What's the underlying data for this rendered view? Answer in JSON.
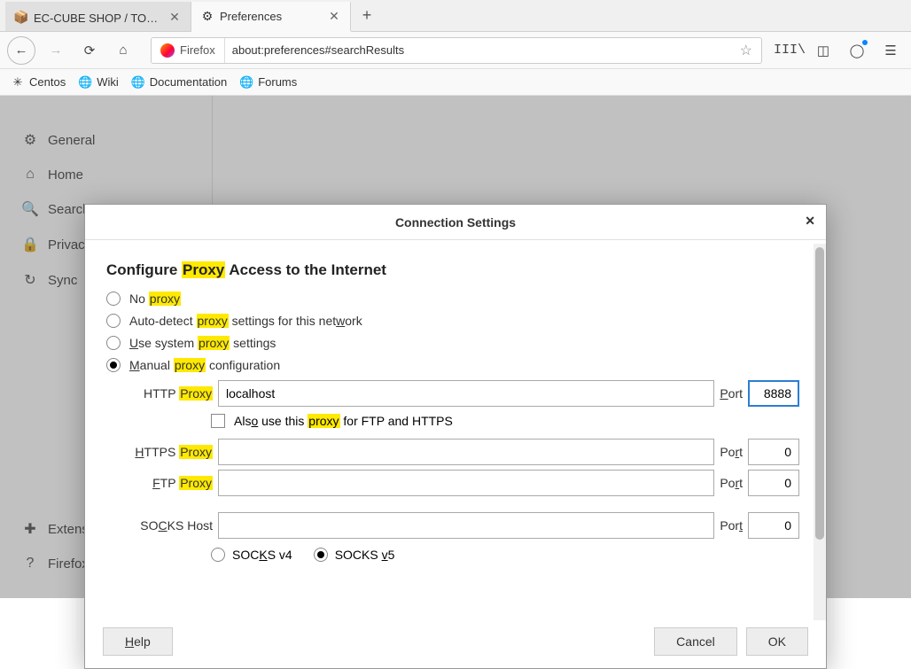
{
  "tabs": {
    "t1": "EC-CUBE SHOP / TOPペ",
    "t2": "Preferences"
  },
  "url": {
    "prefix": "Firefox",
    "value": "about:preferences#searchResults"
  },
  "bookmarks": {
    "b1": "Centos",
    "b2": "Wiki",
    "b3": "Documentation",
    "b4": "Forums"
  },
  "sidebar": {
    "s1": "General",
    "s2": "Home",
    "s3": "Search",
    "s4": "Privacy & Security",
    "s5": "Sync",
    "s6": "Extensions & Themes",
    "s7": "Firefox Support"
  },
  "dialog": {
    "title": "Connection Settings",
    "heading_pre": "Configure ",
    "heading_hl": "Proxy",
    "heading_post": " Access to the Internet",
    "r1_pre": "No ",
    "r1_hl": "proxy",
    "r2_pre": "Auto-detect ",
    "r2_hl": "proxy",
    "r2_post": " settings for this net",
    "r2_u": "w",
    "r2_end": "ork",
    "r3_u": "U",
    "r3_mid": "se system ",
    "r3_hl": "proxy",
    "r3_end": " settings",
    "r4_u": "M",
    "r4_mid": "anual ",
    "r4_hl": "proxy",
    "r4_end": " configuration",
    "http_label_pre": "HTTP ",
    "http_label_hl": "Proxy",
    "http_value": "localhost",
    "http_port_u": "P",
    "http_port_end": "ort",
    "http_port": "8888",
    "also_pre": "Als",
    "also_u": "o",
    "also_mid": " use this ",
    "also_hl": "proxy",
    "also_end": " for FTP and HTTPS",
    "https_u": "H",
    "https_mid": "TTPS ",
    "https_hl": "Proxy",
    "https_port_pre": "Po",
    "https_port_u": "r",
    "https_port_end": "t",
    "https_port": "0",
    "ftp_u": "F",
    "ftp_mid": "TP ",
    "ftp_hl": "Proxy",
    "ftp_port_pre": "Po",
    "ftp_port_u": "r",
    "ftp_port_end": "t",
    "ftp_port": "0",
    "socks_pre": "SO",
    "socks_u": "C",
    "socks_end": "KS Host",
    "socks_port_pre": "Por",
    "socks_port_u": "t",
    "socks_port": "0",
    "v4_pre": "SOC",
    "v4_u": "K",
    "v4_end": "S v4",
    "v5_pre": "SOCKS ",
    "v5_u": "v",
    "v5_end": "5",
    "help_u": "H",
    "help_end": "elp",
    "cancel": "Cancel",
    "ok": "OK"
  }
}
